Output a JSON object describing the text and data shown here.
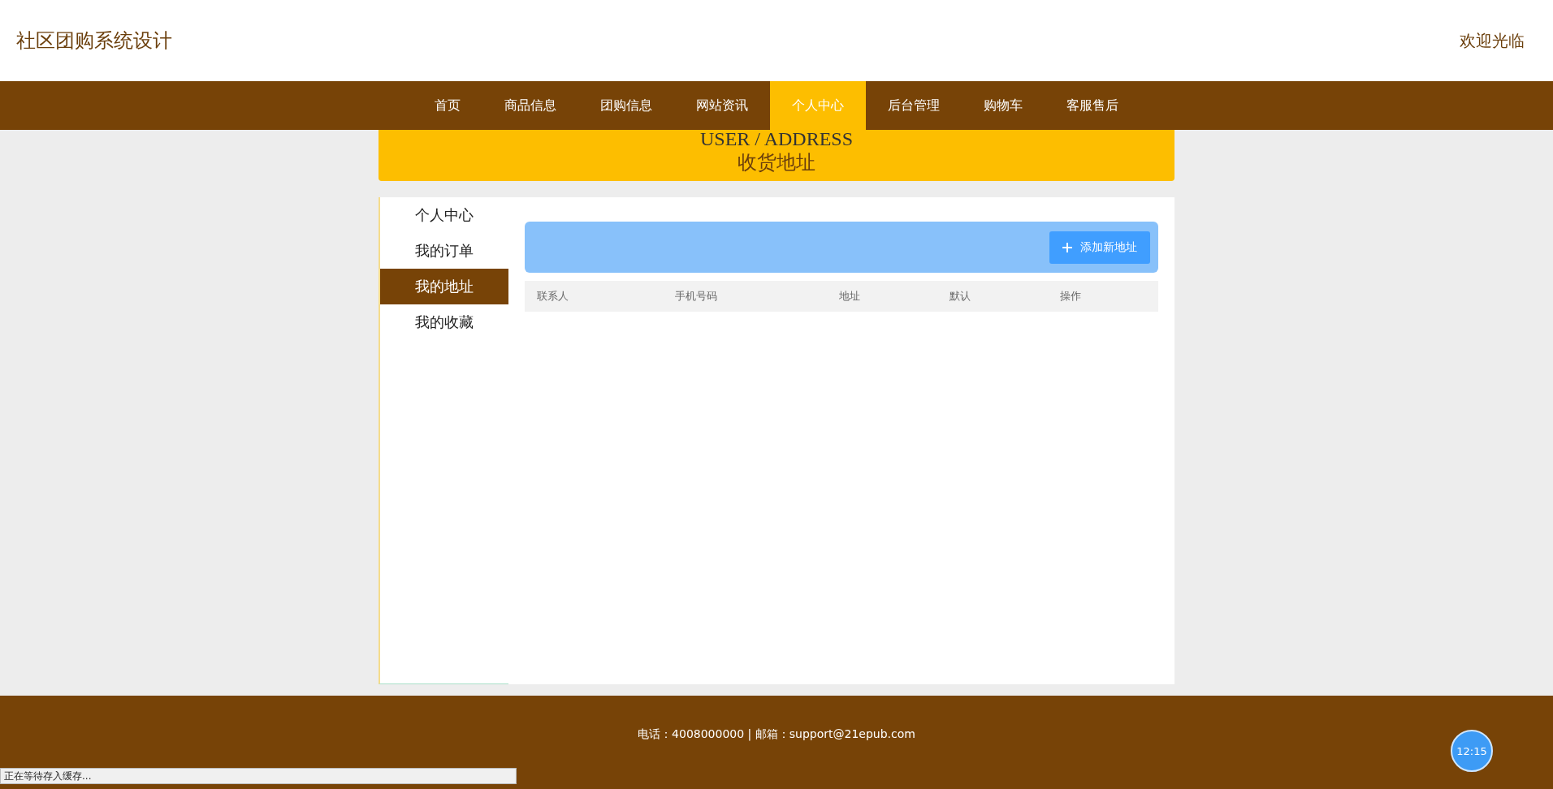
{
  "site_title": "社区团购系统设计",
  "welcome": "欢迎光临",
  "nav": [
    {
      "label": "首页",
      "selected": false
    },
    {
      "label": "商品信息",
      "selected": false
    },
    {
      "label": "团购信息",
      "selected": false
    },
    {
      "label": "网站资讯",
      "selected": false
    },
    {
      "label": "个人中心",
      "selected": true
    },
    {
      "label": "后台管理",
      "selected": false
    },
    {
      "label": "购物车",
      "selected": false
    },
    {
      "label": "客服售后",
      "selected": false
    }
  ],
  "banner": {
    "title": "USER / ADDRESS",
    "subtitle": "收货地址"
  },
  "sidebar": [
    {
      "label": "个人中心",
      "selected": false
    },
    {
      "label": "我的订单",
      "selected": false
    },
    {
      "label": "我的地址",
      "selected": true
    },
    {
      "label": "我的收藏",
      "selected": false
    }
  ],
  "toolbar": {
    "add_button": "添加新地址"
  },
  "table": {
    "columns": [
      "联系人",
      "手机号码",
      "地址",
      "默认",
      "操作"
    ]
  },
  "footer": "电话：4008000000 | 邮箱：support@21epub.com",
  "clock": "12:15",
  "status_bar": "正在等待存入缓存..."
}
